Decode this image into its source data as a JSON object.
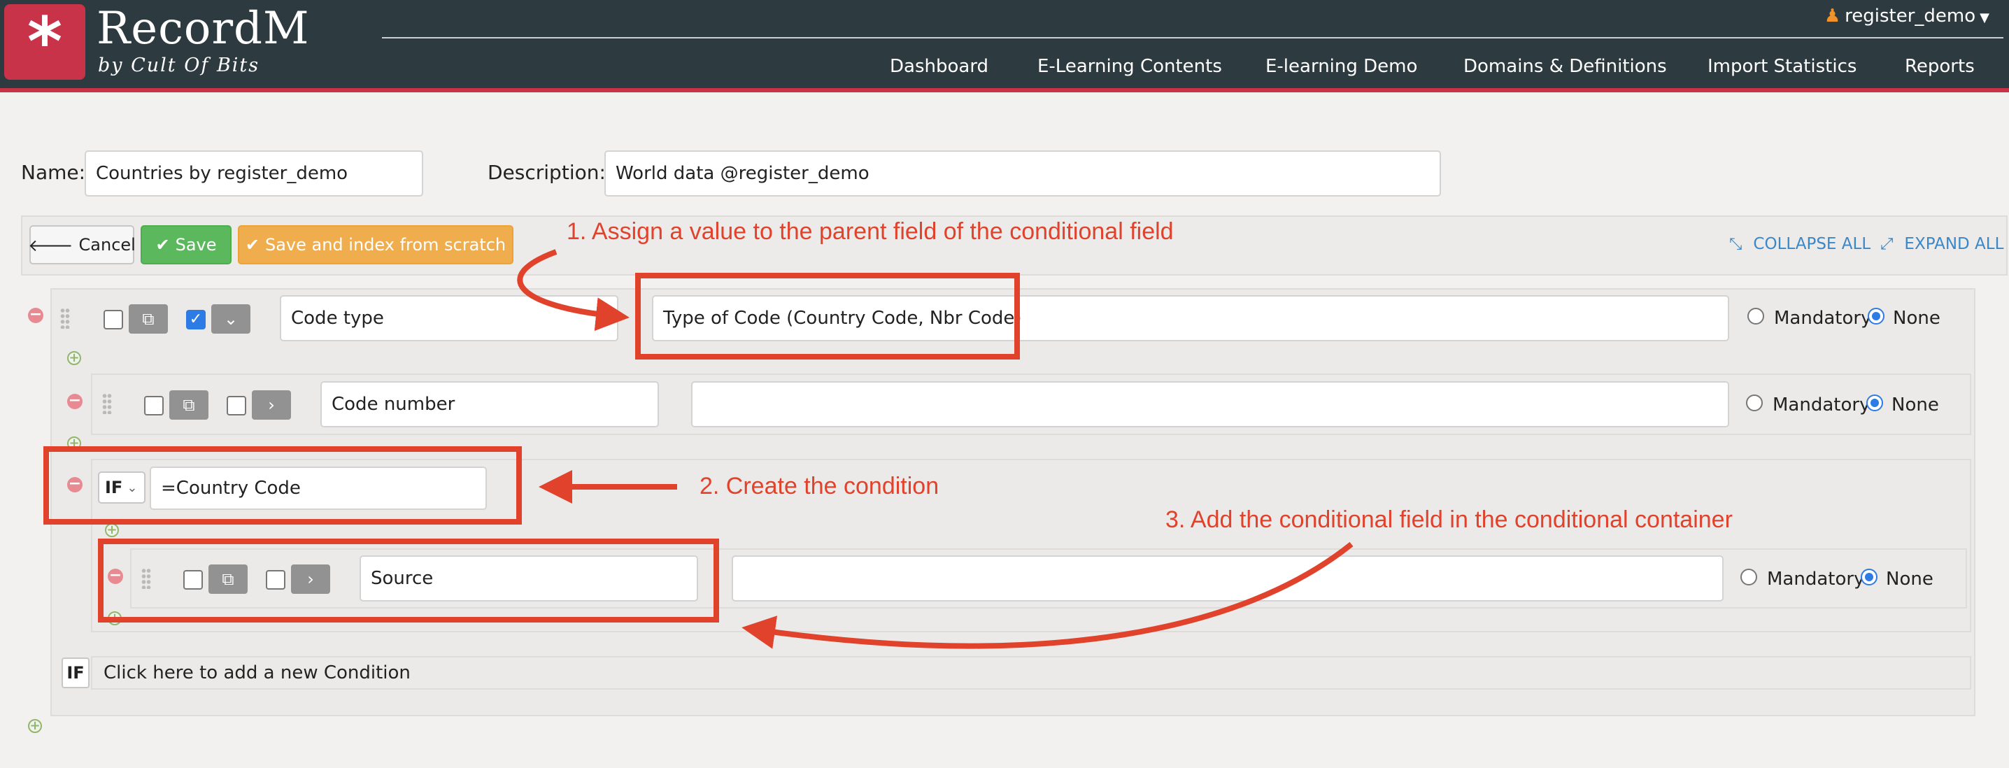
{
  "header": {
    "logo_glyph": "*",
    "brand_title": "RecordM",
    "brand_subtitle": "by Cult Of Bits",
    "user": "register_demo",
    "nav": [
      "Dashboard",
      "E-Learning Contents",
      "E-learning Demo",
      "Domains & Definitions",
      "Import Statistics",
      "Reports"
    ]
  },
  "definition": {
    "name_label": "Name:",
    "name_value": "Countries by register_demo",
    "description_label": "Description:",
    "description_value": "World data @register_demo"
  },
  "toolbar": {
    "cancel": "Cancel",
    "save": "Save",
    "save_index": "Save and index from scratch",
    "collapse_all": "COLLAPSE ALL",
    "expand_all": "EXPAND ALL"
  },
  "fields": {
    "code_type": {
      "name": "Code type",
      "description": "Type of Code (Country Code, Nbr Code)",
      "checkbox1": false,
      "checkbox2": true,
      "requirement": "None"
    },
    "code_number": {
      "name": "Code number",
      "description": "",
      "checkbox1": false,
      "checkbox2": false,
      "requirement": "None"
    },
    "condition": {
      "operator": "IF",
      "expression": "=Country Code"
    },
    "source": {
      "name": "Source",
      "description": "",
      "checkbox1": false,
      "checkbox2": false,
      "requirement": "None"
    },
    "mandatory_label": "Mandatory",
    "none_label": "None",
    "add_condition_badge": "IF",
    "add_condition_text": "Click here to add a new Condition"
  },
  "annotations": {
    "step1": "1. Assign a value to the parent field of the conditional field",
    "step2": "2. Create the condition",
    "step3": "3. Add the conditional field in the conditional container"
  },
  "colors": {
    "header_bg": "#2d3a3f",
    "brand_red": "#c8334a",
    "annotation_red": "#e0422b",
    "save_green": "#5cb85c",
    "save_index_orange": "#f0ad4e",
    "link_blue": "#3a87c9"
  }
}
